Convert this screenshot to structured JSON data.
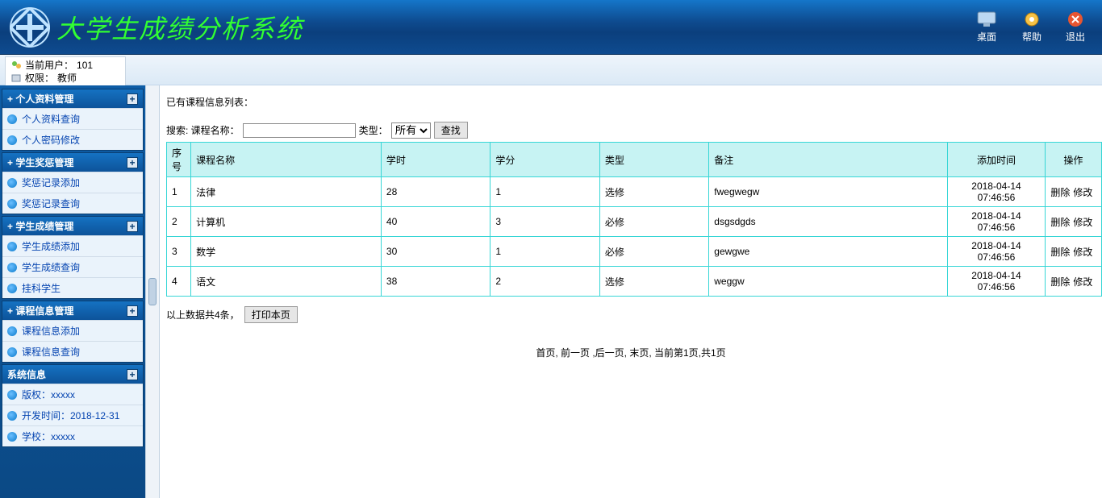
{
  "app": {
    "title": "大学生成绩分析系统"
  },
  "top_actions": {
    "desktop": "桌面",
    "help": "帮助",
    "exit": "退出"
  },
  "userbar": {
    "current_user_label": "当前用户：",
    "current_user": "101",
    "role_label": "权限：",
    "role": "教师"
  },
  "sidebar": [
    {
      "title": "+ 个人资料管理",
      "items": [
        "个人资料查询",
        "个人密码修改"
      ]
    },
    {
      "title": "+ 学生奖惩管理",
      "items": [
        "奖惩记录添加",
        "奖惩记录查询"
      ]
    },
    {
      "title": "+ 学生成绩管理",
      "items": [
        "学生成绩添加",
        "学生成绩查询",
        "挂科学生"
      ]
    },
    {
      "title": "+ 课程信息管理",
      "items": [
        "课程信息添加",
        "课程信息查询"
      ]
    },
    {
      "title": "系统信息",
      "items": [
        "版权：xxxxx",
        "开发时间：2018-12-31",
        "学校：xxxxx"
      ]
    }
  ],
  "main": {
    "list_title": "已有课程信息列表：",
    "search_label": "搜索: 课程名称：",
    "type_label": "类型：",
    "type_options": [
      "所有"
    ],
    "type_selected": "所有",
    "search_button": "查找",
    "columns": [
      "序号",
      "课程名称",
      "学时",
      "学分",
      "类型",
      "备注",
      "添加时间",
      "操作"
    ],
    "rows": [
      {
        "idx": "1",
        "name": "法律",
        "hours": "28",
        "credit": "1",
        "type": "选修",
        "remark": "fwegwegw",
        "time": "2018-04-14 07:46:56"
      },
      {
        "idx": "2",
        "name": "计算机",
        "hours": "40",
        "credit": "3",
        "type": "必修",
        "remark": "dsgsdgds",
        "time": "2018-04-14 07:46:56"
      },
      {
        "idx": "3",
        "name": "数学",
        "hours": "30",
        "credit": "1",
        "type": "必修",
        "remark": "gewgwe",
        "time": "2018-04-14 07:46:56"
      },
      {
        "idx": "4",
        "name": "语文",
        "hours": "38",
        "credit": "2",
        "type": "选修",
        "remark": "weggw",
        "time": "2018-04-14 07:46:56"
      }
    ],
    "op_delete": "删除",
    "op_edit": "修改",
    "summary": "以上数据共4条，",
    "print_button": "打印本页",
    "pager": "首页, 前一页 ,后一页, 末页, 当前第1页,共1页"
  }
}
